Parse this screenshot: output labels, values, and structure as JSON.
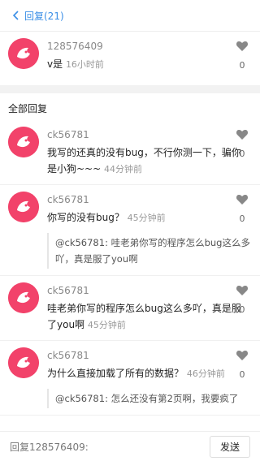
{
  "header": {
    "back_label": "回复(21)"
  },
  "main_comment": {
    "user": "128576409",
    "text": "v是",
    "time": "16小时前",
    "likes": "0"
  },
  "section_title": "全部回复",
  "replies": [
    {
      "user": "ck56781",
      "text": "我写的还真的没有bug，不行你测一下，骗你是小狗~~~",
      "time": "44分钟前",
      "likes": "0",
      "quote": ""
    },
    {
      "user": "ck56781",
      "text": "你写的没有bug？",
      "time": "45分钟前",
      "likes": "0",
      "quote": "@ck56781: 哇老弟你写的程序怎么bug这么多吖，真是服了you啊"
    },
    {
      "user": "ck56781",
      "text": "哇老弟你写的程序怎么bug这么多吖，真是服了you啊",
      "time": "45分钟前",
      "likes": "0",
      "quote": ""
    },
    {
      "user": "ck56781",
      "text": "为什么直接加载了所有的数据？",
      "time": "46分钟前",
      "likes": "0",
      "quote": "@ck56781: 怎么还没有第2页啊，我要疯了"
    }
  ],
  "footer": {
    "input_placeholder": "回复128576409:",
    "send_label": "发送"
  },
  "colors": {
    "accent": "#3a8ee6",
    "avatar": "#f2426a"
  },
  "icons": {
    "back": "chevron-left-icon",
    "like": "heart-icon",
    "avatar": "mouse-logo-icon"
  }
}
